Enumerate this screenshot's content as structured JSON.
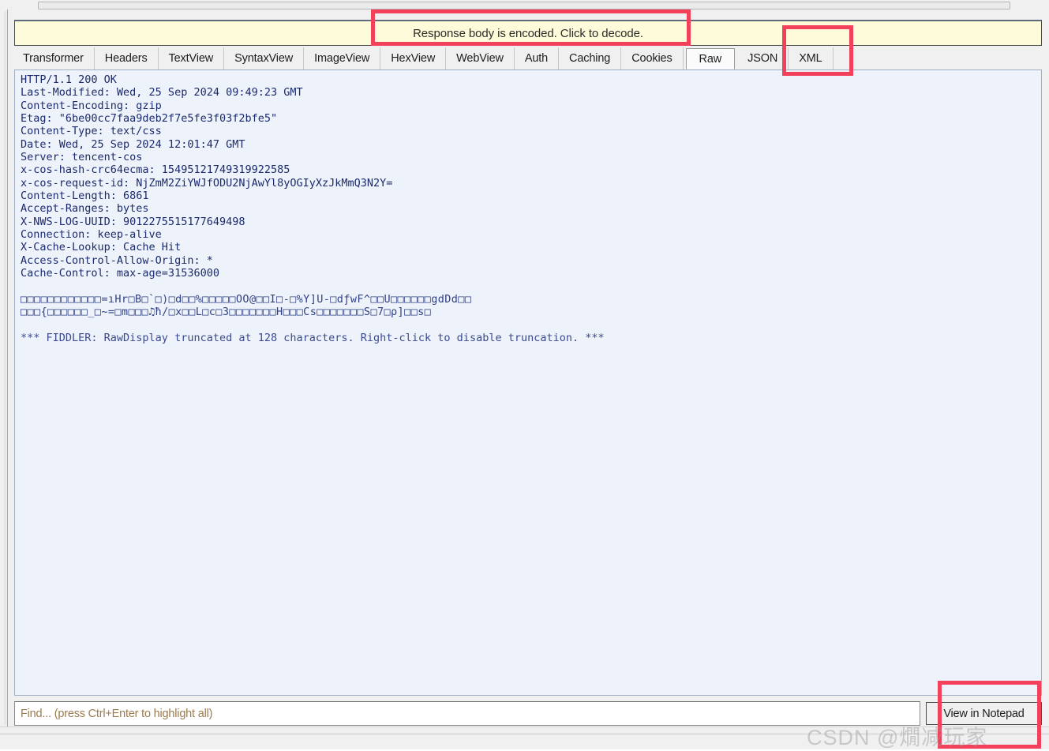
{
  "notice": {
    "text": "Response body is encoded. Click to decode."
  },
  "tabs": [
    {
      "label": "Transformer",
      "selected": false
    },
    {
      "label": "Headers",
      "selected": false
    },
    {
      "label": "TextView",
      "selected": false
    },
    {
      "label": "SyntaxView",
      "selected": false
    },
    {
      "label": "ImageView",
      "selected": false
    },
    {
      "label": "HexView",
      "selected": false
    },
    {
      "label": "WebView",
      "selected": false
    },
    {
      "label": "Auth",
      "selected": false
    },
    {
      "label": "Caching",
      "selected": false
    },
    {
      "label": "Cookies",
      "selected": false
    },
    {
      "label": "Raw",
      "selected": true
    },
    {
      "label": "JSON",
      "selected": false
    },
    {
      "label": "XML",
      "selected": false
    }
  ],
  "raw_response": {
    "status_line": "HTTP/1.1 200 OK",
    "headers": [
      "Last-Modified: Wed, 25 Sep 2024 09:49:23 GMT",
      "Content-Encoding: gzip",
      "Etag: \"6be00cc7faa9deb2f7e5fe3f03f2bfe5\"",
      "Content-Type: text/css",
      "Date: Wed, 25 Sep 2024 12:01:47 GMT",
      "Server: tencent-cos",
      "x-cos-hash-crc64ecma: 15495121749319922585",
      "x-cos-request-id: NjZmM2ZiYWJfODU2NjAwYl8yOGIyXzJkMmQ3N2Y=",
      "Content-Length: 6861",
      "Accept-Ranges: bytes",
      "X-NWS-LOG-UUID: 9012275515177649498",
      "Connection: keep-alive",
      "X-Cache-Lookup: Cache Hit",
      "Access-Control-Allow-Origin: *",
      "Cache-Control: max-age=31536000"
    ],
    "body_lines": [
      "□□□□□□□□□□□□=ıHr□B□`□)□d□□%□□□□□OO@□□I□-□%Y]U-□dƒwF^□□U□□□□□□gdDd□□",
      "□□□{□□□□□□_□~=□m□□□♫ħ/□x□□L□c□3□□□□□□□H□□□Cs□□□□□□□S□7□ρ]□□s□"
    ],
    "truncation_notice": "*** FIDDLER: RawDisplay truncated at 128 characters. Right-click to disable truncation. ***"
  },
  "find": {
    "value": "",
    "placeholder": "Find... (press Ctrl+Enter to highlight all)"
  },
  "buttons": {
    "view_in_notepad": "View in Notepad"
  },
  "watermark": {
    "text": "CSDN @燗减玩家"
  },
  "colors": {
    "annotation": "#f4415b",
    "notice_background": "#fdfbd9",
    "textview_background": "#eef3fb",
    "text": "#1a2a6c"
  }
}
